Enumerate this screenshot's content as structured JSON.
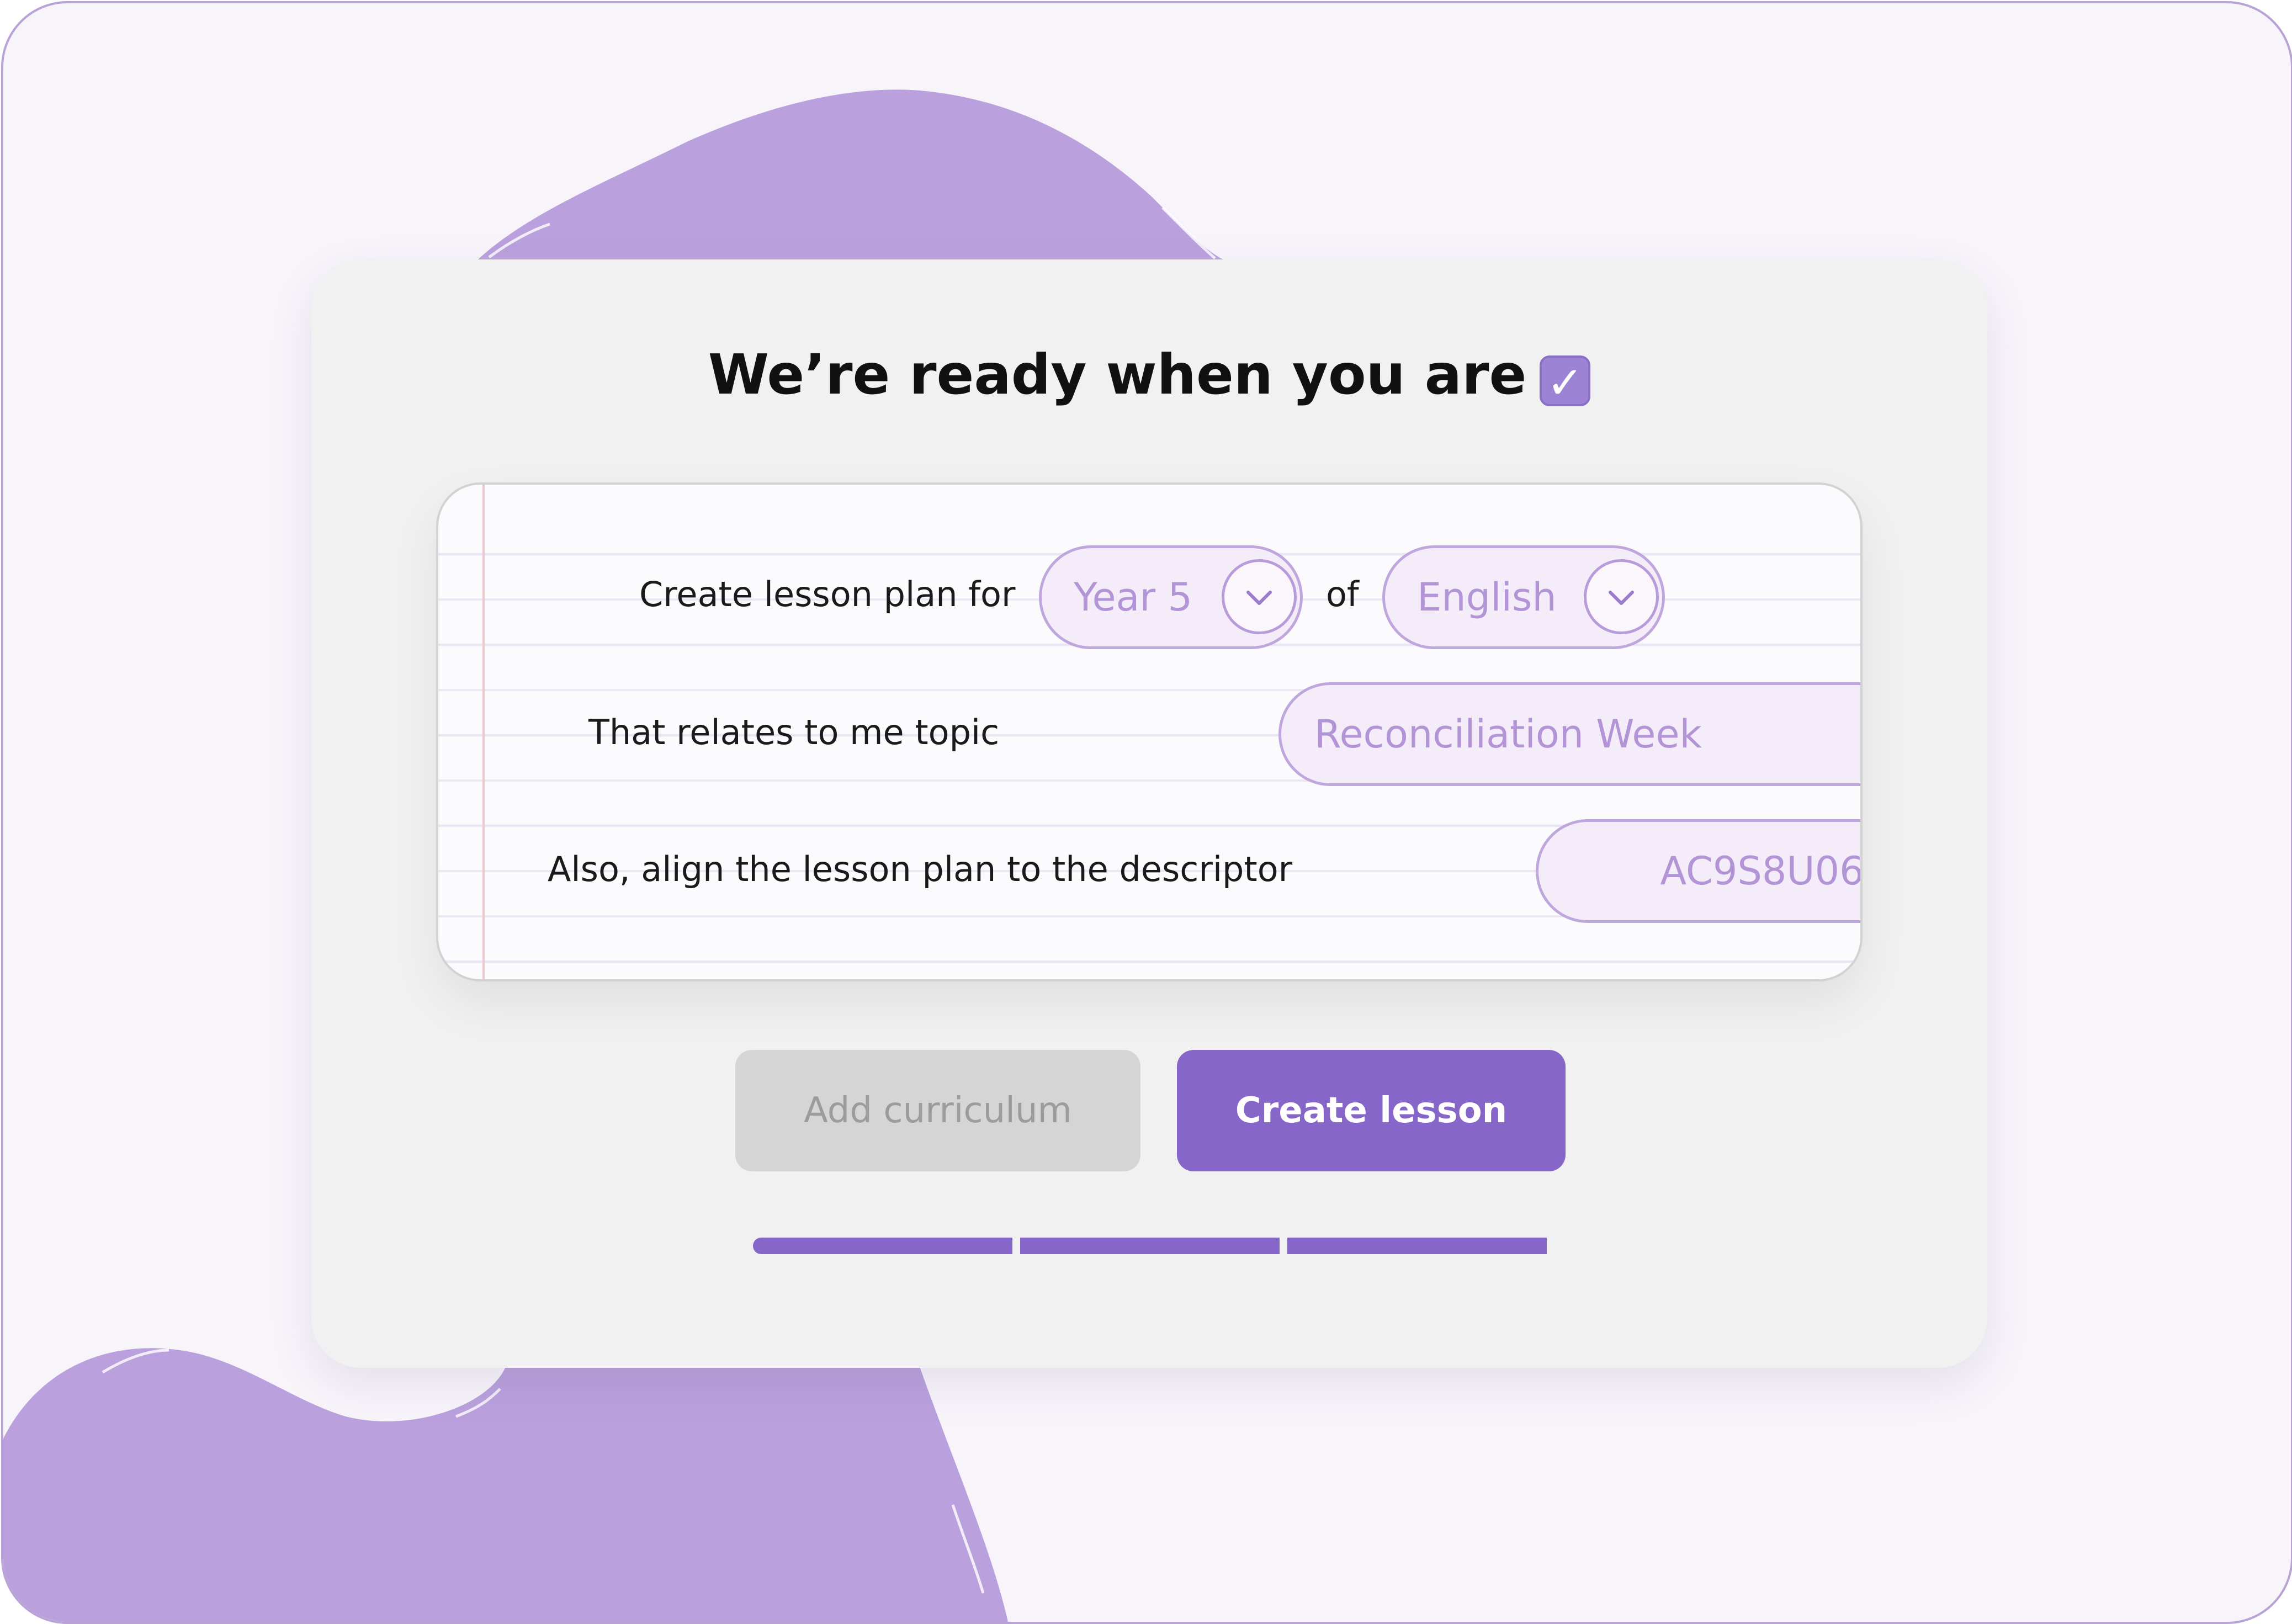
{
  "title": "We’re ready when you are",
  "title_icon": "check-box-icon",
  "form": {
    "row1": {
      "prefix": "Create lesson plan for",
      "year_value": "Year 5",
      "connector": "of",
      "subject_value": "English"
    },
    "row2": {
      "label": "That relates to me topic",
      "topic_value": "Reconciliation Week"
    },
    "row3": {
      "label": "Also, align the lesson plan to the descriptor",
      "descriptor_value": "AC9S8U06"
    }
  },
  "actions": {
    "add_curriculum": "Add curriculum",
    "create_lesson": "Create lesson"
  },
  "progress": {
    "total_steps": 3,
    "completed_steps": 3
  },
  "colors": {
    "accent": "#8667c9",
    "blob": "#baa1dd",
    "pill_text": "#b394d6",
    "background": "#f7f4fa"
  }
}
